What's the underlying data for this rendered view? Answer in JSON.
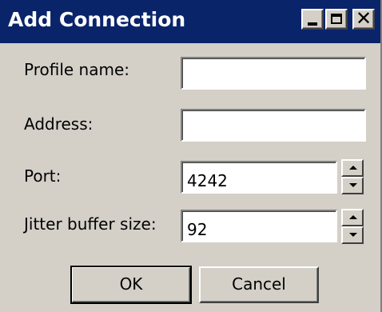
{
  "window": {
    "title": "Add Connection",
    "controls": {
      "minimize_icon": "minimize-icon",
      "maximize_icon": "maximize-icon",
      "close_icon": "close-icon",
      "close_glyph": "✕"
    }
  },
  "form": {
    "profile_name": {
      "label": "Profile name:",
      "value": ""
    },
    "address": {
      "label": "Address:",
      "value": ""
    },
    "port": {
      "label": "Port:",
      "value": "4242"
    },
    "jitter_buffer_size": {
      "label": "Jitter buffer size:",
      "value": "92"
    }
  },
  "buttons": {
    "ok_label": "OK",
    "cancel_label": "Cancel"
  },
  "colors": {
    "titlebar": "#0a246a",
    "face": "#d4d0c8"
  }
}
